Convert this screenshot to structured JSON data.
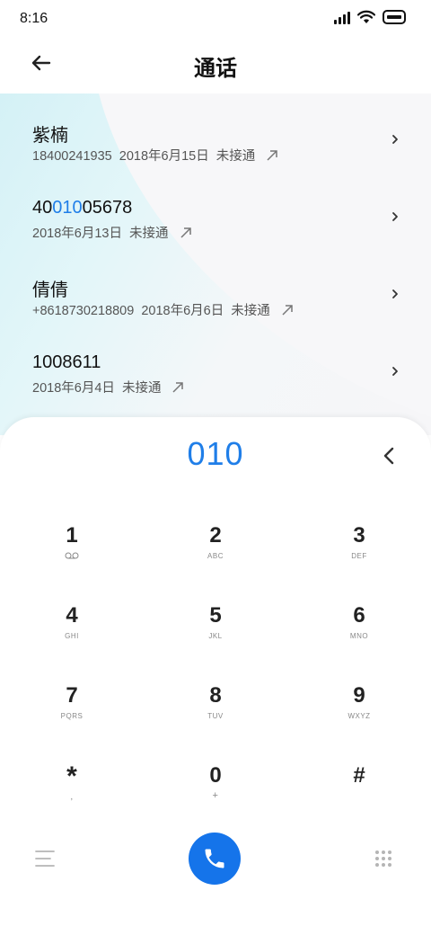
{
  "status_bar": {
    "time": "8:16"
  },
  "header": {
    "title": "通话"
  },
  "calls": [
    {
      "name": "紫楠",
      "detail": "18400241935  2018年6月15日  未接通"
    },
    {
      "name_prefix": "40",
      "name_highlight": "010",
      "name_suffix": "05678",
      "detail": "2018年6月13日  未接通"
    },
    {
      "name": "倩倩",
      "detail": "+8618730218809  2018年6月6日  未接通"
    },
    {
      "name": "1008611",
      "detail": "2018年6月4日  未接通"
    }
  ],
  "dialpad": {
    "number": "010",
    "keys": [
      {
        "digit": "1",
        "letters": ""
      },
      {
        "digit": "2",
        "letters": "ABC"
      },
      {
        "digit": "3",
        "letters": "DEF"
      },
      {
        "digit": "4",
        "letters": "GHI"
      },
      {
        "digit": "5",
        "letters": "JKL"
      },
      {
        "digit": "6",
        "letters": "MNO"
      },
      {
        "digit": "7",
        "letters": "PQRS"
      },
      {
        "digit": "8",
        "letters": "TUV"
      },
      {
        "digit": "9",
        "letters": "WXYZ"
      },
      {
        "digit": "*",
        "letters": ","
      },
      {
        "digit": "0",
        "letters": "+"
      },
      {
        "digit": "#",
        "letters": ""
      }
    ]
  },
  "icons": {
    "back": "arrow-left-icon",
    "chevron": "chevron-right-icon",
    "outgoing": "arrow-up-right-icon",
    "backspace": "chevron-left-icon",
    "voicemail": "voicemail-icon",
    "menu": "menu-icon",
    "call": "phone-icon",
    "dialpad": "dialpad-icon"
  },
  "colors": {
    "accent": "#1f7ee8",
    "call_button": "#1574ea"
  }
}
